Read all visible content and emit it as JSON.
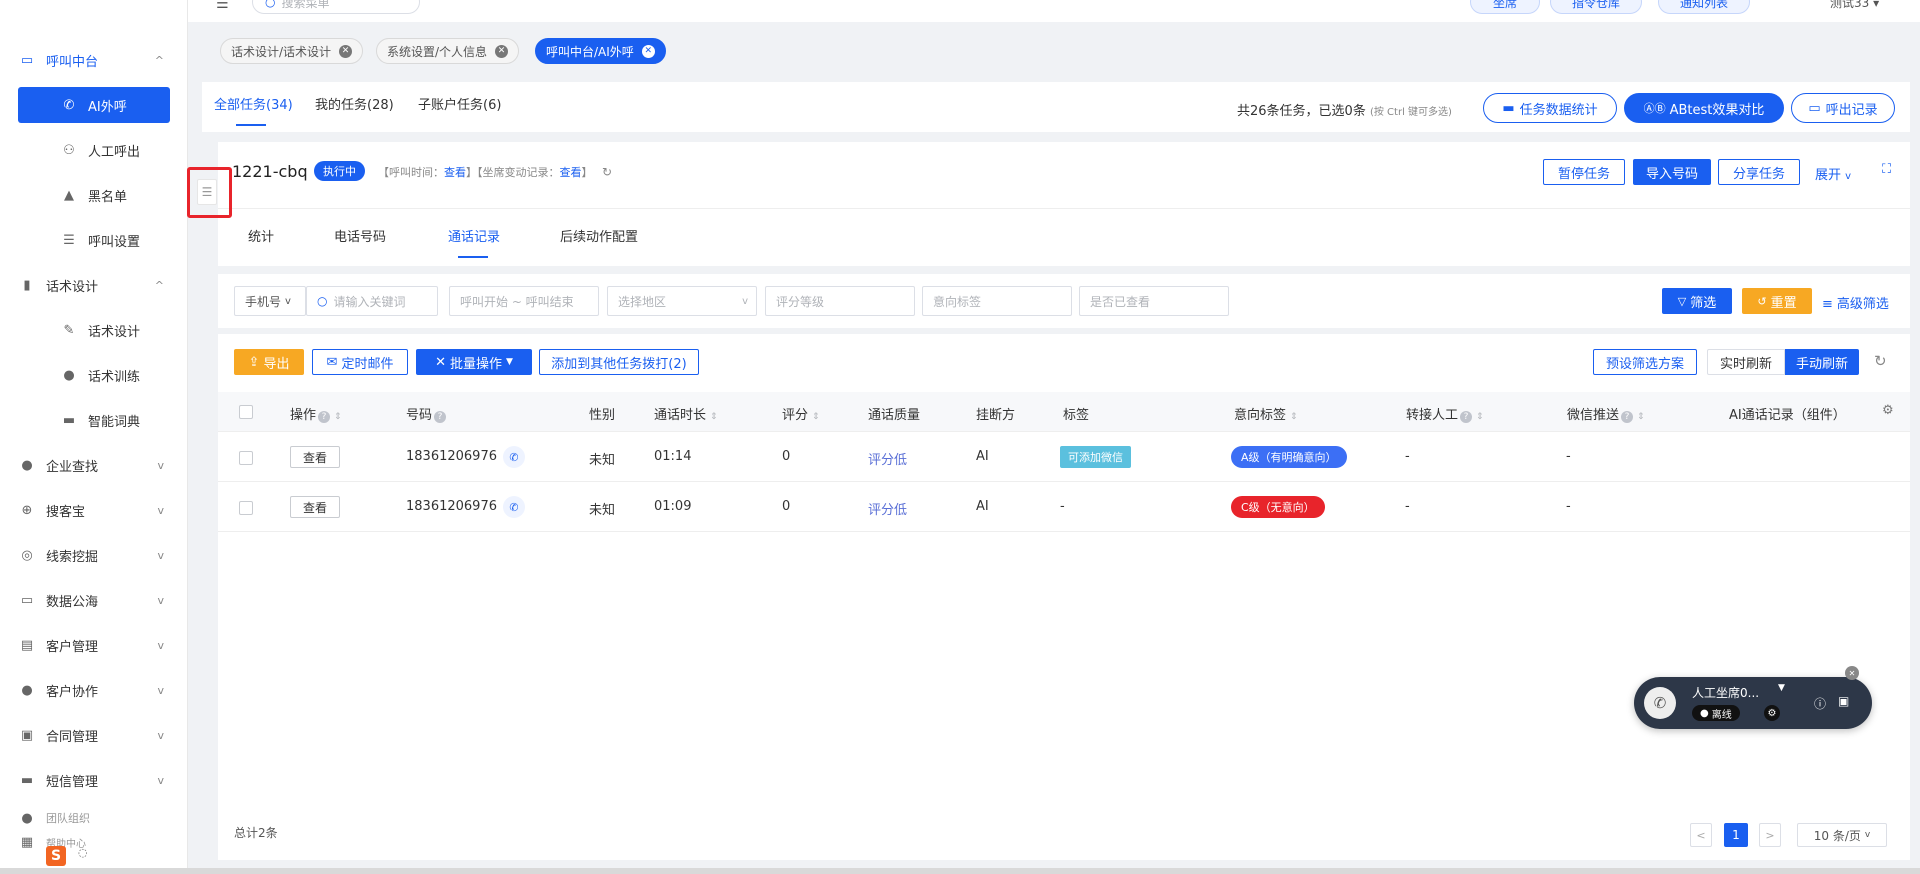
{
  "sidebar": {
    "items": [
      {
        "label": "呼叫中台",
        "icon": "monitor-icon"
      },
      {
        "label": "AI外呼",
        "icon": "phone-icon"
      },
      {
        "label": "人工呼出",
        "icon": "users-icon"
      },
      {
        "label": "黑名单",
        "icon": "warning-icon"
      },
      {
        "label": "呼叫设置",
        "icon": "sliders-icon"
      },
      {
        "label": "话术设计",
        "icon": "book-icon"
      },
      {
        "label": "话术设计",
        "icon": "edit-icon"
      },
      {
        "label": "话术训练",
        "icon": "chat-icon"
      },
      {
        "label": "智能词典",
        "icon": "dictionary-icon"
      },
      {
        "label": "企业查找",
        "icon": "bulb-icon"
      },
      {
        "label": "搜客宝",
        "icon": "search-icon"
      },
      {
        "label": "线索挖掘",
        "icon": "target-icon"
      },
      {
        "label": "数据公海",
        "icon": "chart-icon"
      },
      {
        "label": "客户管理",
        "icon": "customer-icon"
      },
      {
        "label": "客户协作",
        "icon": "collab-icon"
      },
      {
        "label": "合同管理",
        "icon": "contract-icon"
      },
      {
        "label": "短信管理",
        "icon": "sms-icon"
      },
      {
        "label": "团队组织",
        "icon": "team-icon"
      },
      {
        "label": "帮助中心",
        "icon": "help-icon"
      }
    ]
  },
  "topbar": {
    "search_placeholder": "搜索菜单",
    "buttons": [
      "坐席",
      "指令仓库",
      "通知列表"
    ],
    "user": "测试33"
  },
  "tags": [
    {
      "label": "话术设计/话术设计"
    },
    {
      "label": "系统设置/个人信息"
    },
    {
      "label": "呼叫中台/AI外呼"
    }
  ],
  "task_tabs": [
    {
      "label": "全部任务(34)"
    },
    {
      "label": "我的任务(28)"
    },
    {
      "label": "子账户任务(6)"
    }
  ],
  "task_summary": "共26条任务，已选0条",
  "task_summary_hint": "(按 Ctrl 键可多选)",
  "header_buttons": {
    "stats": "任务数据统计",
    "abtest": "ABtest效果对比",
    "call_log": "呼出记录"
  },
  "task": {
    "name": "1221-cbq",
    "status": "执行中",
    "meta_prefix1": "【呼叫时间：",
    "meta_link1": "查看",
    "meta_mid": "】【坐席变动记录：",
    "meta_link2": "查看",
    "meta_suffix": "】"
  },
  "task_actions": {
    "pause": "暂停任务",
    "import": "导入号码",
    "share": "分享任务",
    "expand": "展开"
  },
  "sub_tabs": [
    {
      "label": "统计"
    },
    {
      "label": "电话号码"
    },
    {
      "label": "通话记录"
    },
    {
      "label": "后续动作配置"
    }
  ],
  "filters": {
    "phone_type": "手机号",
    "keyword_placeholder": "请输入关键词",
    "time_placeholder": "呼叫开始 ~ 呼叫结束",
    "region_placeholder": "选择地区",
    "score_placeholder": "评分等级",
    "intent_placeholder": "意向标签",
    "viewed_placeholder": "是否已查看",
    "filter_btn": "筛选",
    "reset_btn": "重置",
    "advanced": "高级筛选"
  },
  "toolbar": {
    "export": "导出",
    "scheduled_mail": "定时邮件",
    "batch": "批量操作",
    "add_other": "添加到其他任务拨打(2)",
    "preset": "预设筛选方案",
    "realtime": "实时刷新",
    "manual": "手动刷新"
  },
  "table": {
    "headers": [
      "操作",
      "号码",
      "性别",
      "通话时长",
      "评分",
      "通话质量",
      "挂断方",
      "标签",
      "意向标签",
      "转接人工",
      "微信推送",
      "AI通话记录（组件）"
    ],
    "rows": [
      {
        "action": "查看",
        "phone": "18361206976",
        "gender": "未知",
        "duration": "01:14",
        "score": "0",
        "quality": "评分低",
        "hangup": "AI",
        "tag": "可添加微信",
        "intent": "A级（有明确意向）",
        "transfer": "-",
        "wechat": "-"
      },
      {
        "action": "查看",
        "phone": "18361206976",
        "gender": "未知",
        "duration": "01:09",
        "score": "0",
        "quality": "评分低",
        "hangup": "AI",
        "tag": "-",
        "intent": "C级（无意向）",
        "transfer": "-",
        "wechat": "-"
      }
    ]
  },
  "footer": {
    "total": "总计2条",
    "page": "1",
    "page_size": "10 条/页"
  },
  "float_widget": {
    "title": "人工坐席0...",
    "status": "离线"
  },
  "colors": {
    "primary": "#1a5ff0",
    "warning": "#f7a823",
    "danger": "#e8242b",
    "tag_cyan": "#5bc0de"
  }
}
